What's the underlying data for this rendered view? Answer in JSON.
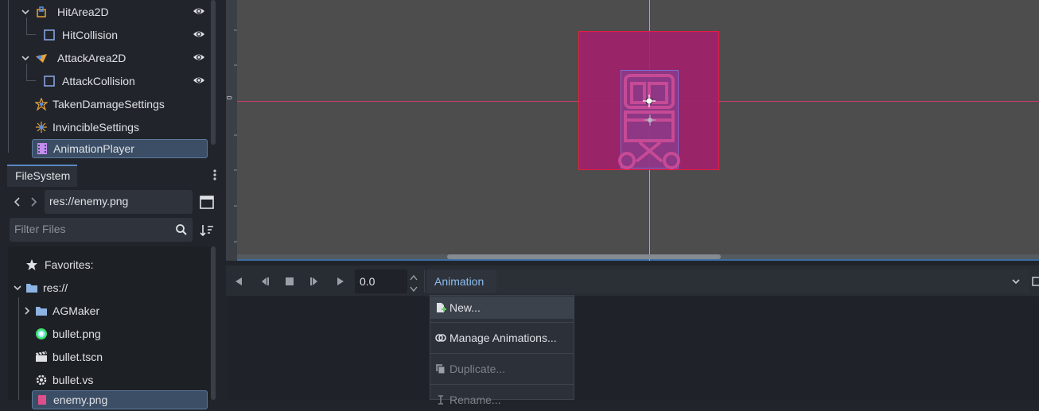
{
  "scene_tree": {
    "nodes": [
      {
        "label": "HitArea2D",
        "icon": "area2d-icon"
      },
      {
        "label": "HitCollision",
        "icon": "collision-shape-icon"
      },
      {
        "label": "AttackArea2D",
        "icon": "area2d-icon"
      },
      {
        "label": "AttackCollision",
        "icon": "collision-shape-icon"
      },
      {
        "label": "TakenDamageSettings",
        "icon": "node-icon"
      },
      {
        "label": "InvincibleSettings",
        "icon": "node-icon"
      },
      {
        "label": "AnimationPlayer",
        "icon": "animation-player-icon",
        "selected": true
      }
    ]
  },
  "filesystem": {
    "tab_label": "FileSystem",
    "path": "res://enemy.png",
    "filter_placeholder": "Filter Files",
    "items": [
      {
        "label": "Favorites:",
        "icon": "star-icon"
      },
      {
        "label": "res://",
        "icon": "folder-icon"
      },
      {
        "label": "AGMaker",
        "icon": "folder-icon"
      },
      {
        "label": "bullet.png",
        "icon": "image-icon"
      },
      {
        "label": "bullet.tscn",
        "icon": "scene-icon"
      },
      {
        "label": "bullet.vs",
        "icon": "visual-script-icon"
      },
      {
        "label": "enemy.png",
        "icon": "image-icon",
        "selected": true
      }
    ]
  },
  "viewport": {
    "ruler_zero": "0",
    "sprite_color": "#a0226a"
  },
  "animation_panel": {
    "time_value": "0.0",
    "animation_button": "Animation",
    "menu": [
      {
        "label": "New...",
        "icon": "new-file-icon",
        "highlighted": true
      },
      {
        "label": "Manage Animations...",
        "icon": "library-icon"
      },
      {
        "label": "Duplicate...",
        "icon": "duplicate-icon",
        "disabled": true
      },
      {
        "label": "Rename...",
        "icon": "rename-icon",
        "disabled": true
      }
    ]
  },
  "colors": {
    "accent": "#5a87c3",
    "selection": "#3b4e65"
  }
}
